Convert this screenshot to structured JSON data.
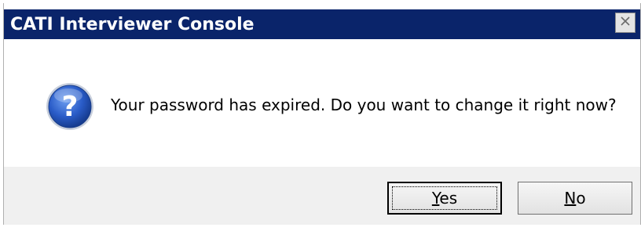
{
  "window": {
    "title": "CATI Interviewer Console",
    "close_icon": "close-icon"
  },
  "message": {
    "icon": "question-icon",
    "text": "Your password has expired. Do you want to change it right now?"
  },
  "buttons": {
    "yes": {
      "mnemonic": "Y",
      "rest": "es"
    },
    "no": {
      "mnemonic": "N",
      "rest": "o"
    }
  },
  "colors": {
    "titlebar": "#0a246a",
    "footer": "#f0f0f0",
    "icon_blue": "#2a5cc8"
  }
}
